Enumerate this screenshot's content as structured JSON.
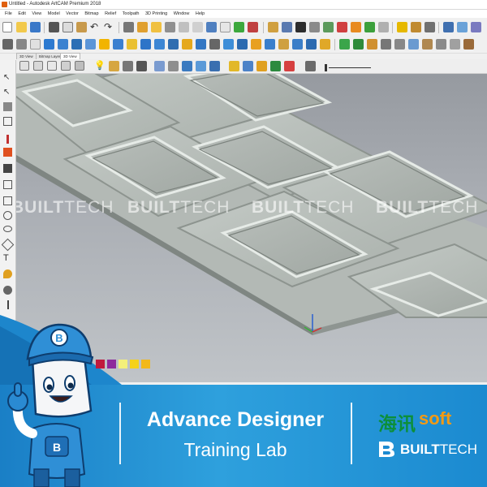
{
  "window": {
    "title": "Untitled - Autodesk ArtCAM Premium 2018"
  },
  "menu": {
    "items": [
      "File",
      "Edit",
      "View",
      "Model",
      "Vector",
      "Bitmap",
      "Relief",
      "Toolpath",
      "3D Printing",
      "Window",
      "Help"
    ]
  },
  "tabs": [
    {
      "label": "3D View"
    },
    {
      "label": "Bitmap Layer"
    },
    {
      "label": "3D View"
    }
  ],
  "viewport": {
    "watermark_bold": "BUILT",
    "watermark_light": "TECH"
  },
  "palette": {
    "colors": [
      "#c01a3c",
      "#8e2b9c",
      "#f4f07a",
      "#f5d21a",
      "#f2b81a"
    ]
  },
  "banner": {
    "title_line1": "Advance Designer",
    "title_line2": "Training Lab"
  },
  "brand": {
    "cn_name": "海讯",
    "soft": "soft",
    "built": "BUILT",
    "tech": "TECH"
  },
  "colors": {
    "banner_blue": "#2396d8",
    "brand_green": "#0c8f3a",
    "brand_orange": "#f29a14"
  }
}
